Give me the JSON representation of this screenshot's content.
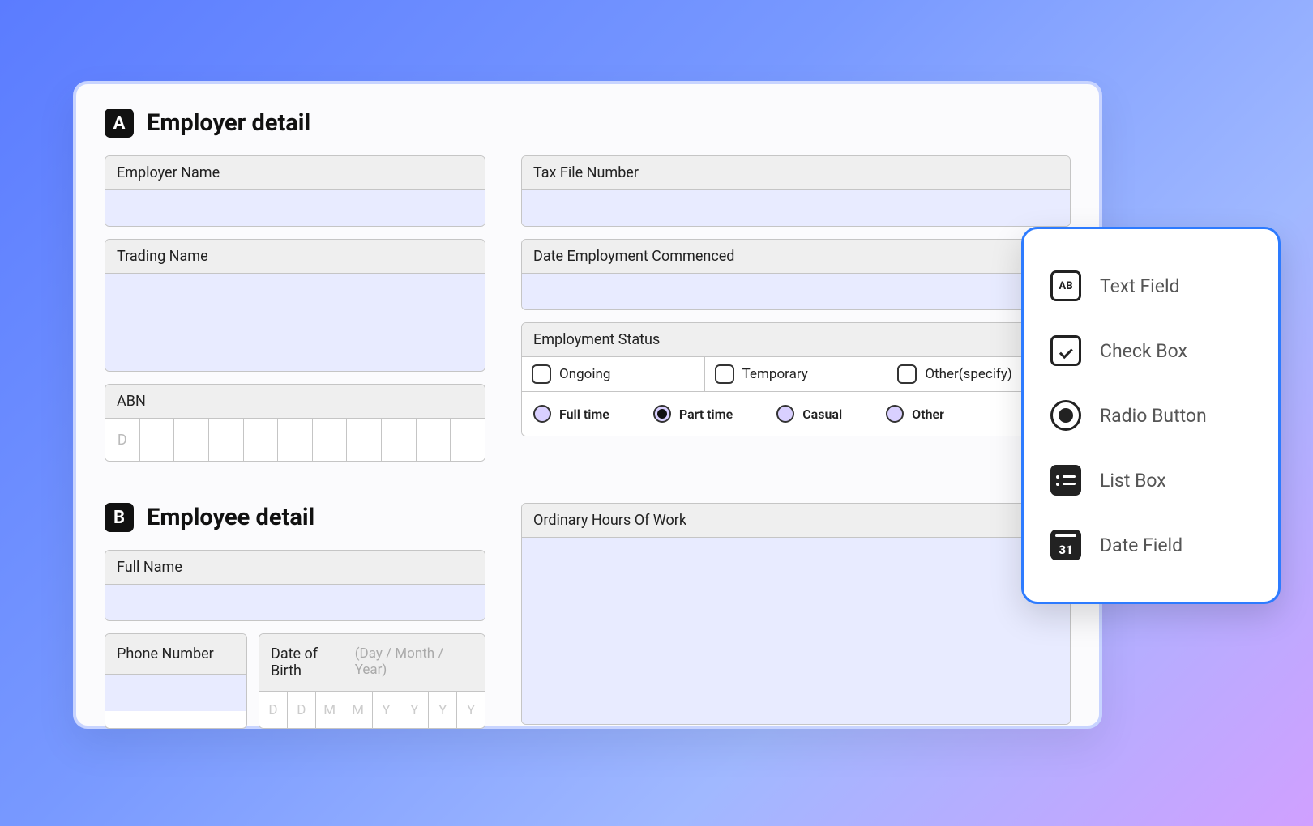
{
  "sections": {
    "a": {
      "badge": "A",
      "title": "Employer detail"
    },
    "b": {
      "badge": "B",
      "title": "Employee detail"
    }
  },
  "fields": {
    "employer_name": "Employer Name",
    "trading_name": "Trading Name",
    "abn": "ABN",
    "abn_placeholder": "D",
    "tax_file_number": "Tax File Number",
    "date_commenced": "Date Employment Commenced",
    "employment_status": "Employment Status",
    "ordinary_hours": "Ordinary Hours Of Work",
    "full_name": "Full Name",
    "phone_number": "Phone Number",
    "date_of_birth": "Date of Birth",
    "dob_hint": "(Day / Month / Year)"
  },
  "status_checks": [
    "Ongoing",
    "Temporary",
    "Other(specify)"
  ],
  "status_radios": [
    {
      "label": "Full time",
      "selected": false
    },
    {
      "label": "Part time",
      "selected": true
    },
    {
      "label": "Casual",
      "selected": false
    },
    {
      "label": "Other",
      "selected": false
    }
  ],
  "dob_cells": [
    "D",
    "D",
    "M",
    "M",
    "Y",
    "Y",
    "Y",
    "Y"
  ],
  "popup": [
    {
      "icon": "text-field-icon",
      "label": "Text Field"
    },
    {
      "icon": "check-box-icon",
      "label": "Check Box"
    },
    {
      "icon": "radio-button-icon",
      "label": "Radio Button"
    },
    {
      "icon": "list-box-icon",
      "label": "List Box"
    },
    {
      "icon": "date-field-icon",
      "label": "Date Field"
    }
  ]
}
